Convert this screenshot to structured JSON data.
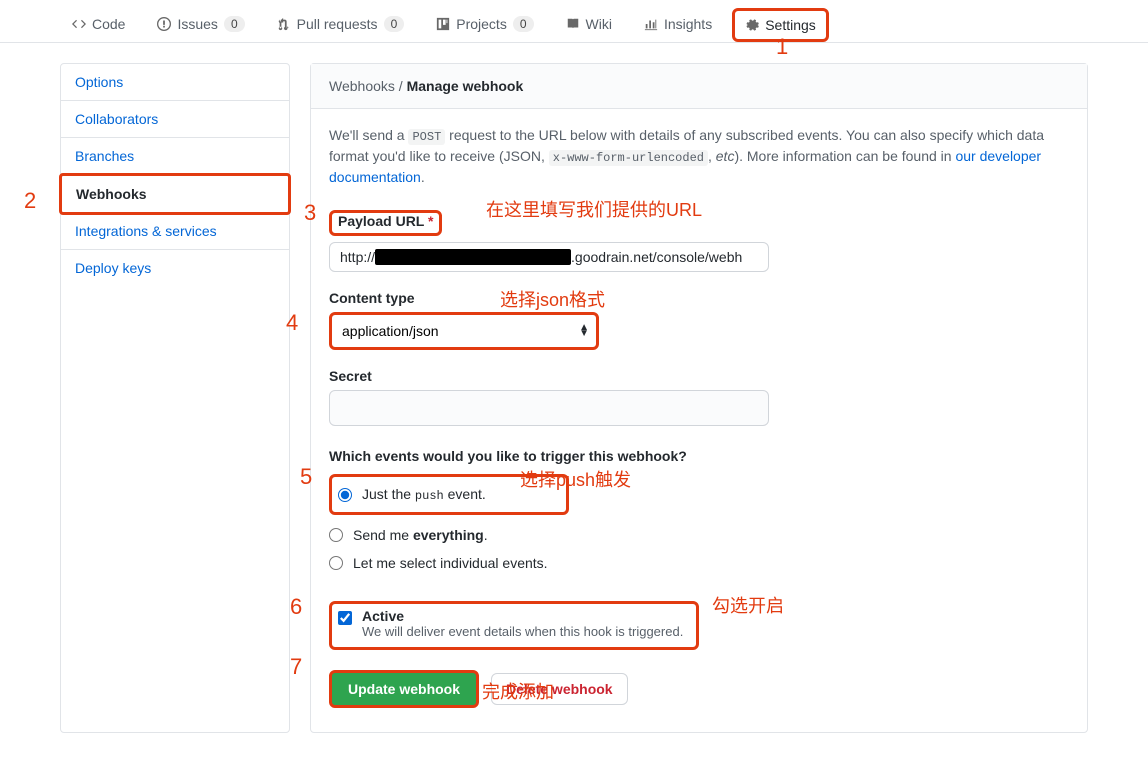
{
  "nav": {
    "code": "Code",
    "issues": "Issues",
    "issues_count": "0",
    "prs": "Pull requests",
    "prs_count": "0",
    "projects": "Projects",
    "projects_count": "0",
    "wiki": "Wiki",
    "insights": "Insights",
    "settings": "Settings"
  },
  "sidebar": {
    "options": "Options",
    "collaborators": "Collaborators",
    "branches": "Branches",
    "webhooks": "Webhooks",
    "integrations": "Integrations & services",
    "deploy_keys": "Deploy keys"
  },
  "breadcrumb": {
    "root": "Webhooks",
    "sep": " / ",
    "current": "Manage webhook"
  },
  "intro": {
    "p1": "We'll send a ",
    "code1": "POST",
    "p2": " request to the URL below with details of any subscribed events. You can also specify which data format you'd like to receive (JSON, ",
    "code2": "x-www-form-urlencoded",
    "p3": ", ",
    "em": "etc",
    "p4": "). More information can be found in ",
    "link": "our developer documentation",
    "p5": "."
  },
  "form": {
    "payload_label": "Payload URL",
    "req": "*",
    "payload_prefix": "http://",
    "payload_suffix": ".goodrain.net/console/webh",
    "content_type_label": "Content type",
    "content_type_value": "application/json",
    "secret_label": "Secret",
    "events_label": "Which events would you like to trigger this webhook?",
    "radio_push_a": "Just the ",
    "radio_push_b": "push",
    "radio_push_c": " event.",
    "radio_all_a": "Send me ",
    "radio_all_b": "everything",
    "radio_all_c": ".",
    "radio_select": "Let me select individual events.",
    "active_label": "Active",
    "active_help": "We will deliver event details when this hook is triggered.",
    "btn_update": "Update webhook",
    "btn_delete": "Delete webhook"
  },
  "anno": {
    "n1": "1",
    "n2": "2",
    "n3": "3",
    "n4": "4",
    "n5": "5",
    "n6": "6",
    "n7": "7",
    "t3": "在这里填写我们提供的URL",
    "t4": "选择json格式",
    "t5": "选择push触发",
    "t6": "勾选开启",
    "t7": "完成添加"
  }
}
